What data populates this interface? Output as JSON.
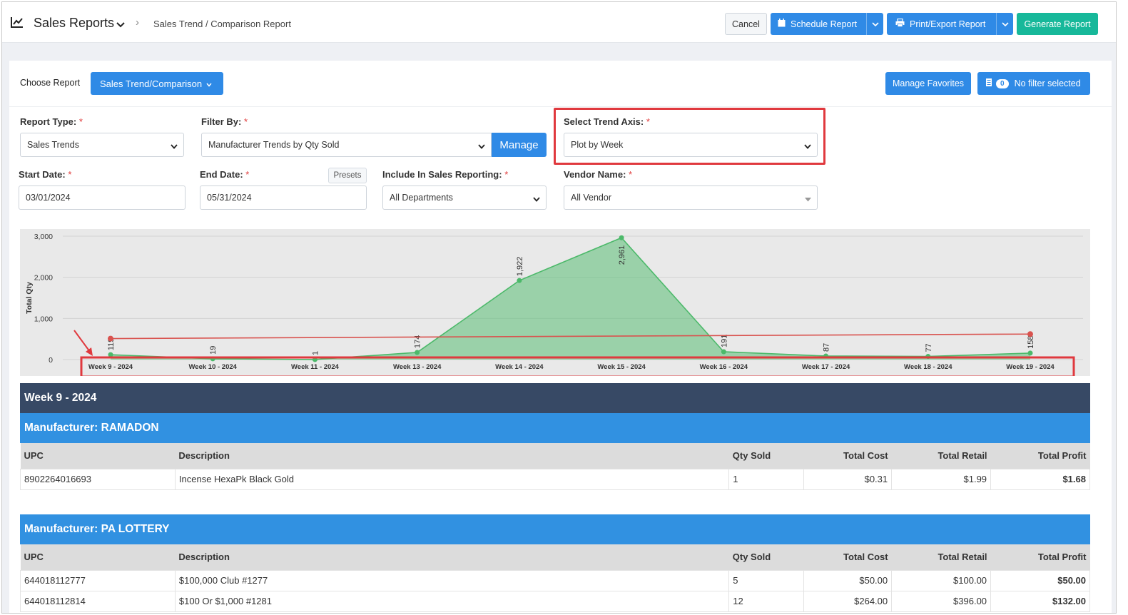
{
  "header": {
    "app_icon": "line-chart-icon",
    "title": "Sales Reports",
    "breadcrumb": "Sales Trend / Comparison Report",
    "cancel_label": "Cancel",
    "schedule_label": "Schedule Report",
    "print_label": "Print/Export Report",
    "generate_label": "Generate Report"
  },
  "toolbar": {
    "choose_label": "Choose Report",
    "choose_value": "Sales Trend/Comparison",
    "favorites_label": "Manage Favorites",
    "filter_count": "0",
    "filter_label": "No filter selected"
  },
  "form": {
    "report_type_label": "Report Type:",
    "report_type_value": "Sales Trends",
    "filter_by_label": "Filter By:",
    "filter_by_value": "Manufacturer Trends by Qty Sold",
    "manage_label": "Manage",
    "trend_axis_label": "Select Trend Axis:",
    "trend_axis_value": "Plot by Week",
    "start_date_label": "Start Date:",
    "start_date_value": "03/01/2024",
    "end_date_label": "End Date:",
    "end_date_value": "05/31/2024",
    "presets_label": "Presets",
    "include_label": "Include In Sales Reporting:",
    "include_value": "All Departments",
    "vendor_label": "Vendor Name:",
    "vendor_value": "All Vendor",
    "required_mark": "*"
  },
  "chart_data": {
    "type": "area",
    "ylabel": "Total Qty",
    "ylim": [
      0,
      3000
    ],
    "yticks": [
      "3,000",
      "2,000",
      "1,000",
      "0"
    ],
    "categories": [
      "Week 9 - 2024",
      "Week 10 - 2024",
      "Week 11 - 2024",
      "Week 13 - 2024",
      "Week 14 - 2024",
      "Week 15 - 2024",
      "Week 16 - 2024",
      "Week 17 - 2024",
      "Week 18 - 2024",
      "Week 19 - 2024"
    ],
    "series": [
      {
        "values": [
          119,
          19,
          1,
          174,
          1922,
          2961,
          191,
          87,
          77,
          158
        ],
        "labels": [
          "119",
          "19",
          "1",
          "174",
          "1,922",
          "2,961",
          "191",
          "87",
          "77",
          "158"
        ],
        "color": "#4cb96a"
      },
      {
        "values": [
          510,
          null,
          null,
          null,
          null,
          null,
          null,
          null,
          null,
          620
        ],
        "color": "#d9534f"
      }
    ]
  },
  "report": {
    "week_title": "Week 9 - 2024",
    "columns": [
      "UPC",
      "Description",
      "Qty Sold",
      "Total Cost",
      "Total Retail",
      "Total Profit"
    ],
    "groups": [
      {
        "manufacturer": "Manufacturer: RAMADON",
        "rows": [
          [
            "8902264016693",
            "Incense HexaPk Black Gold",
            "1",
            "$0.31",
            "$1.99",
            "$1.68"
          ]
        ]
      },
      {
        "manufacturer": "Manufacturer: PA LOTTERY",
        "rows": [
          [
            "644018112777",
            "$100,000 Club #1277",
            "5",
            "$50.00",
            "$100.00",
            "$50.00"
          ],
          [
            "644018112814",
            "$100 Or $1,000 #1281",
            "12",
            "$264.00",
            "$396.00",
            "$132.00"
          ]
        ]
      }
    ]
  },
  "colors": {
    "primary": "#2f8ae6",
    "success": "#17b89a",
    "highlight": "#e0393e",
    "week_bar": "#374965",
    "manufacturer_bar": "#3191e1"
  }
}
